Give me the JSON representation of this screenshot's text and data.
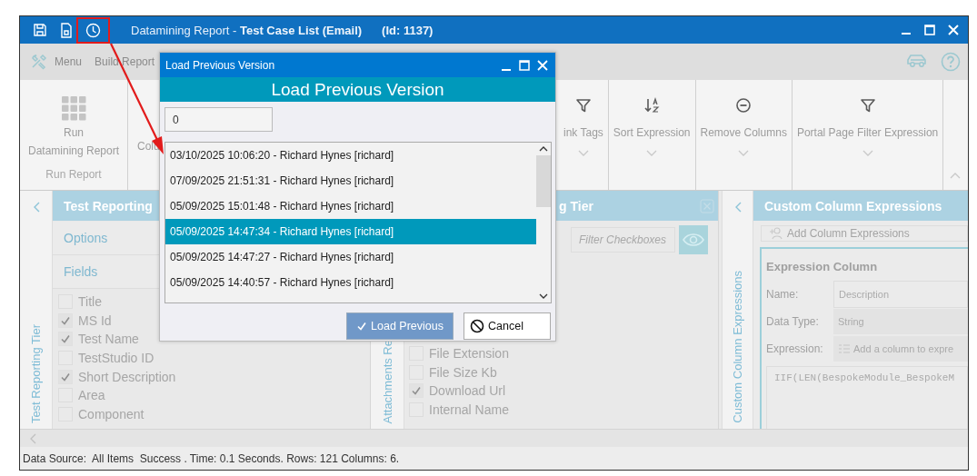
{
  "window": {
    "title": "Datamining Report - **Test Case List (Email)**",
    "id_label": "(Id: 1137)"
  },
  "menu_bar": {
    "items": [
      "Menu",
      "Build Report"
    ]
  },
  "ribbon": {
    "run": {
      "label": "Run",
      "sublabel": "Datamining Report",
      "group": "Run Report"
    },
    "partial_label": "Colu",
    "commands": [
      {
        "label": "ink Tags",
        "kind": "filter"
      },
      {
        "label": "Sort Expression",
        "kind": "sort"
      },
      {
        "label": "Remove Columns",
        "kind": "remove"
      },
      {
        "label": "Portal Page Filter Expression",
        "kind": "filter"
      }
    ]
  },
  "left_panel": {
    "strip_label": "Test Reporting Tier",
    "header": "Test Reporting",
    "sections": [
      "Options",
      "Fields"
    ],
    "fields": [
      {
        "label": "Title",
        "checked": false
      },
      {
        "label": "MS Id",
        "checked": true
      },
      {
        "label": "Test Name",
        "checked": true
      },
      {
        "label": "TestStudio ID",
        "checked": false
      },
      {
        "label": "Short Description",
        "checked": true
      },
      {
        "label": "Area",
        "checked": false
      },
      {
        "label": "Component",
        "checked": false
      }
    ]
  },
  "middle_panel": {
    "strip_label": "Attachments Re",
    "header": "g Tier",
    "filter_placeholder": "Filter Checkboxes",
    "fields": [
      {
        "label": "File Extension",
        "checked": false
      },
      {
        "label": "File Size Kb",
        "checked": false
      },
      {
        "label": "Download Url",
        "checked": true
      },
      {
        "label": "Internal Name",
        "checked": false
      }
    ]
  },
  "right_panel": {
    "strip_label": "Custom Column Expressions",
    "header": "Custom Column Expressions",
    "add_button": "Add Column Expressions",
    "group_title": "Expression Column",
    "rows": [
      {
        "label": "Name:",
        "value": "Description",
        "kind": "input"
      },
      {
        "label": "Data Type:",
        "value": "String",
        "kind": "select"
      },
      {
        "label": "Expression:",
        "value": "Add a column to expre",
        "kind": "picker"
      }
    ],
    "code": "IIF(LEN(BespokeModule_BespokeM"
  },
  "status_bar": {
    "text": "Data Source:  All Items  Success . Time: 0.1 Seconds. Rows: 121 Columns: 6."
  },
  "dialog": {
    "title": "Load Previous Version",
    "heading": "Load Previous Version",
    "search_value": "0",
    "versions": [
      {
        "label": "03/10/2025 10:06:20 - Richard Hynes [richard]",
        "selected": false
      },
      {
        "label": "07/09/2025 21:51:31 - Richard Hynes [richard]",
        "selected": false
      },
      {
        "label": "05/09/2025 15:01:48 - Richard Hynes [richard]",
        "selected": false
      },
      {
        "label": "05/09/2025 14:47:34 - Richard Hynes [richard]",
        "selected": true
      },
      {
        "label": "05/09/2025 14:47:27 - Richard Hynes [richard]",
        "selected": false
      },
      {
        "label": "05/09/2025 14:40:57 - Richard Hynes [richard]",
        "selected": false
      }
    ],
    "buttons": [
      {
        "label": "Load Previous",
        "kind": "primary"
      },
      {
        "label": "Cancel",
        "kind": "cancel"
      }
    ]
  }
}
